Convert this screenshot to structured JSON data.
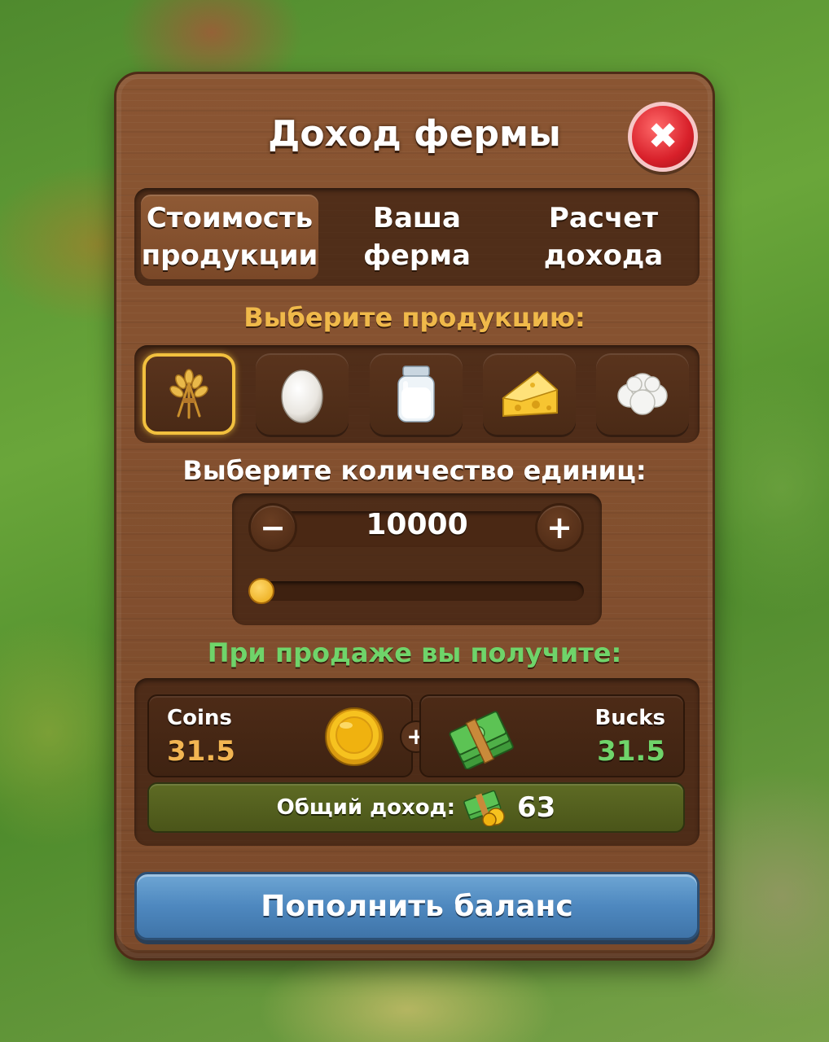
{
  "dialog": {
    "title": "Доход фермы",
    "close_icon": "close-icon"
  },
  "tabs": [
    {
      "line1": "Стоимость",
      "line2": "продукции",
      "active": true
    },
    {
      "line1": "Ваша",
      "line2": "ферма",
      "active": false
    },
    {
      "line1": "Расчет",
      "line2": "дохода",
      "active": false
    }
  ],
  "products": {
    "label": "Выберите продукцию:",
    "label_color": "#f0b94a",
    "items": [
      {
        "icon": "wheat-icon",
        "selected": true
      },
      {
        "icon": "egg-icon",
        "selected": false
      },
      {
        "icon": "milk-jar-icon",
        "selected": false
      },
      {
        "icon": "cheese-icon",
        "selected": false
      },
      {
        "icon": "wool-icon",
        "selected": false
      }
    ]
  },
  "quantity": {
    "label": "Выберите количество единиц:",
    "minus": "−",
    "plus": "+",
    "value": "10000",
    "slider_fraction": 0.0
  },
  "result": {
    "label": "При продаже вы получите:",
    "label_color": "#6fd46a",
    "coins": {
      "label": "Coins",
      "value": "31.5",
      "color": "#f2b552",
      "icon": "gold-coin-icon"
    },
    "plus": "+",
    "bucks": {
      "label": "Bucks",
      "value": "31.5",
      "color": "#6fd46a",
      "icon": "cash-stack-icon"
    },
    "total": {
      "label": "Общий доход:",
      "value": "63",
      "icon": "money-coins-icon"
    }
  },
  "topup_button": {
    "label": "Пополнить баланс"
  }
}
